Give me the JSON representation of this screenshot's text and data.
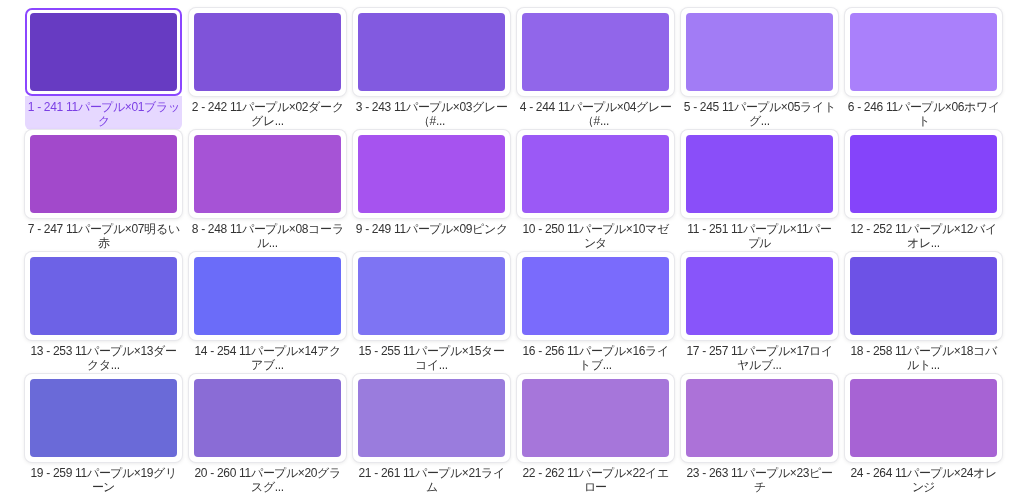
{
  "swatches": [
    {
      "label": "1 - 241 11パープル×01ブラック",
      "color": "#673bc2",
      "selected": true
    },
    {
      "label": "2 - 242 11パープル×02ダークグレ...",
      "color": "#7f53d9",
      "selected": false
    },
    {
      "label": "3 - 243 11パープル×03グレー（#...",
      "color": "#825ae0",
      "selected": false
    },
    {
      "label": "4 - 244 11パープル×04グレー（#...",
      "color": "#9166ea",
      "selected": false
    },
    {
      "label": "5 - 245 11パープル×05ライトグ...",
      "color": "#a27cf5",
      "selected": false
    },
    {
      "label": "6 - 246 11パープル×06ホワイト",
      "color": "#aa80fb",
      "selected": false
    },
    {
      "label": "7 - 247 11パープル×07明るい赤",
      "color": "#a249cb",
      "selected": false
    },
    {
      "label": "8 - 248 11パープル×08コーラル...",
      "color": "#a653d6",
      "selected": false
    },
    {
      "label": "9 - 249 11パープル×09ピンク",
      "color": "#a653ef",
      "selected": false
    },
    {
      "label": "10 - 250 11パープル×10マゼンタ",
      "color": "#9b59f6",
      "selected": false
    },
    {
      "label": "11 - 251 11パープル×11パープル",
      "color": "#8a4ef9",
      "selected": false
    },
    {
      "label": "12 - 252 11パープル×12バイオレ...",
      "color": "#8544fa",
      "selected": false
    },
    {
      "label": "13 - 253 11パープル×13ダークタ...",
      "color": "#6d62e6",
      "selected": false
    },
    {
      "label": "14 - 254 11パープル×14アクアブ...",
      "color": "#6b6cf9",
      "selected": false
    },
    {
      "label": "15 - 255 11パープル×15ターコイ...",
      "color": "#7e74f3",
      "selected": false
    },
    {
      "label": "16 - 256 11パープル×16ライトブ...",
      "color": "#7a6bfc",
      "selected": false
    },
    {
      "label": "17 - 257 11パープル×17ロイヤルブ...",
      "color": "#8855fa",
      "selected": false
    },
    {
      "label": "18 - 258 11パープル×18コバルト...",
      "color": "#6d52e6",
      "selected": false
    },
    {
      "label": "19 - 259 11パープル×19グリーン",
      "color": "#6a6ad8",
      "selected": false
    },
    {
      "label": "20 - 260 11パープル×20グラスグ...",
      "color": "#8a6cd6",
      "selected": false
    },
    {
      "label": "21 - 261 11パープル×21ライム",
      "color": "#9a7cdd",
      "selected": false
    },
    {
      "label": "22 - 262 11パープル×22イエロー",
      "color": "#a676da",
      "selected": false
    },
    {
      "label": "23 - 263 11パープル×23ピーチ",
      "color": "#ac72d8",
      "selected": false
    },
    {
      "label": "24 - 264 11パープル×24オレンジ",
      "color": "#a763d4",
      "selected": false
    }
  ]
}
